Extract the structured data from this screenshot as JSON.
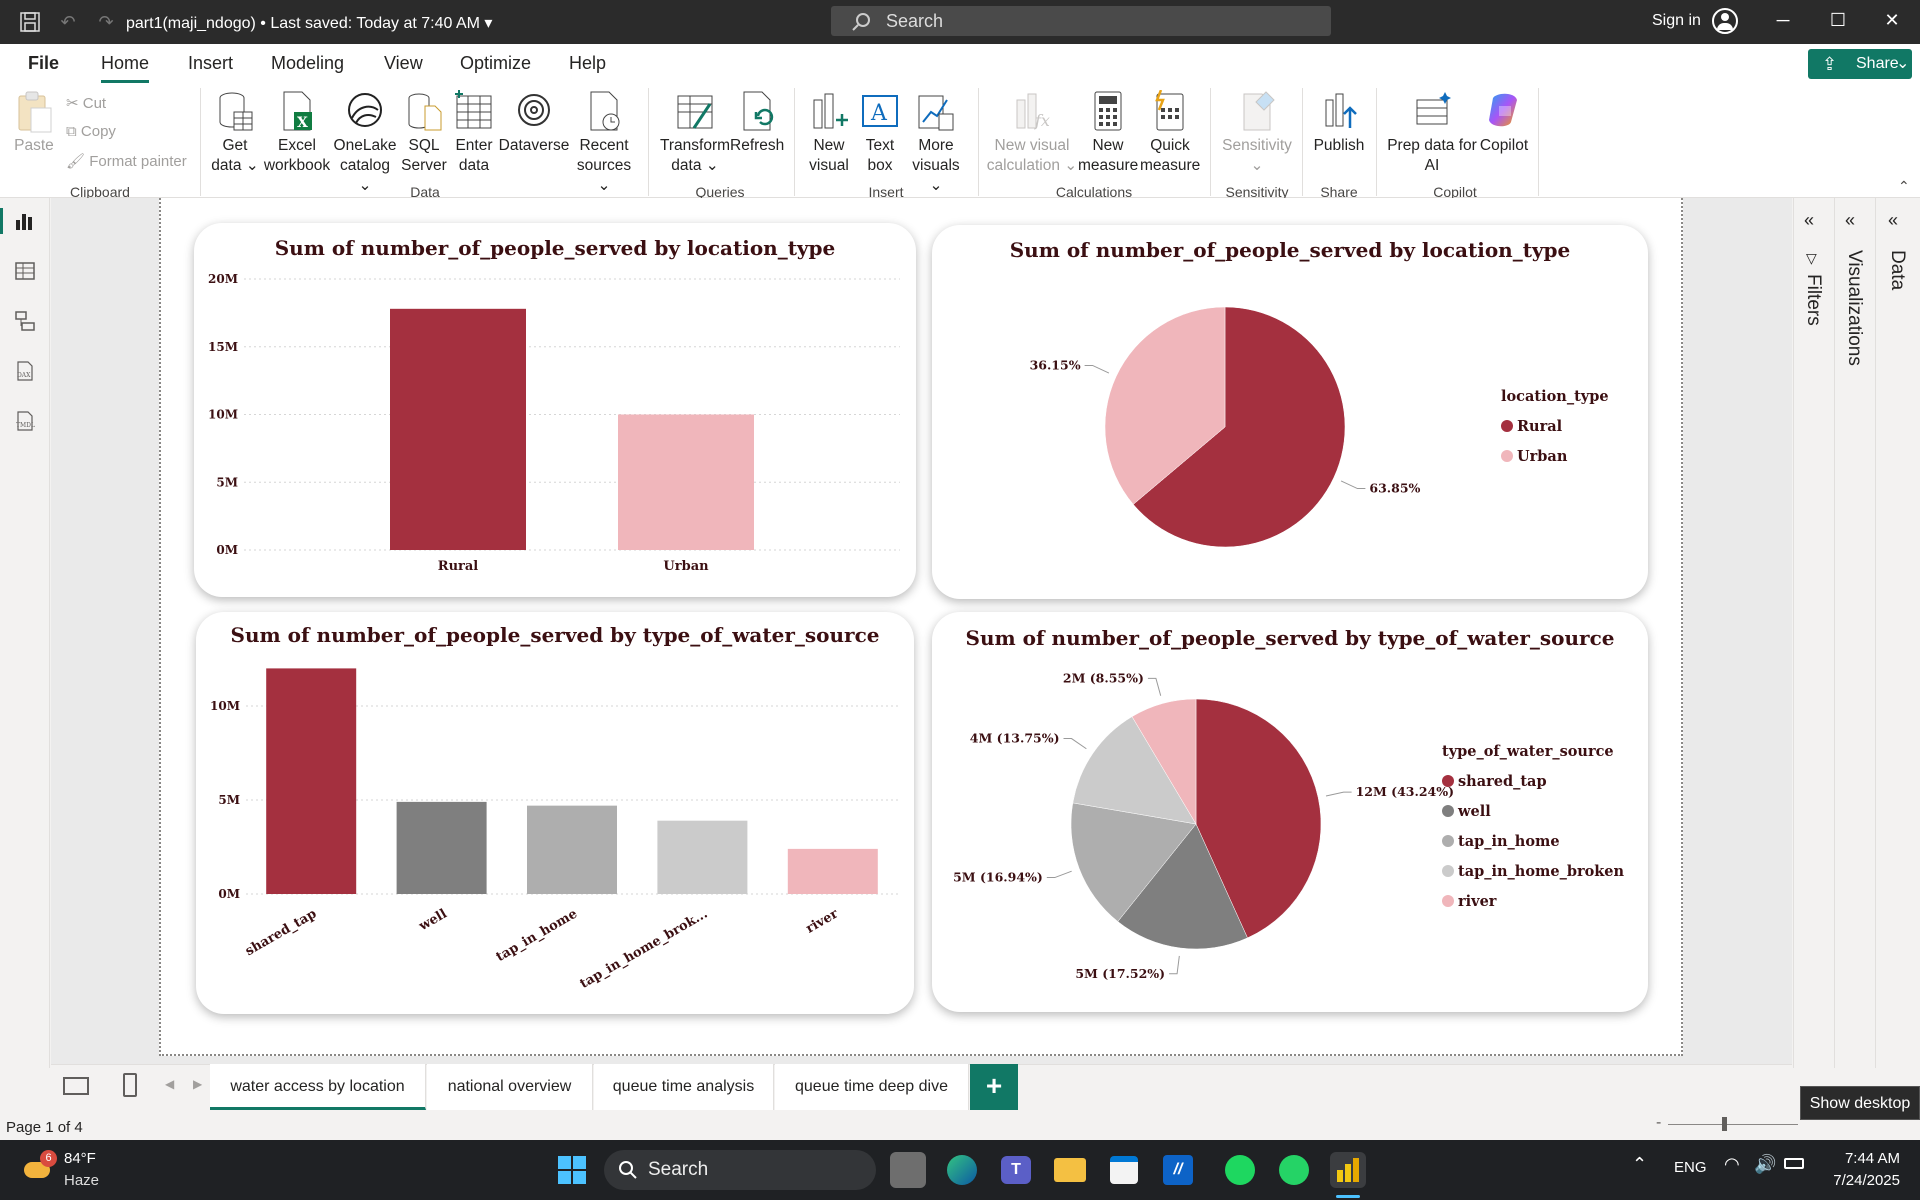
{
  "titlebar": {
    "file_title": "part1(maji_ndogo) • Last saved: Today at 7:40 AM",
    "search_label": "Search",
    "signin": "Sign in"
  },
  "menu": {
    "items": [
      "File",
      "Home",
      "Insert",
      "Modeling",
      "View",
      "Optimize",
      "Help"
    ],
    "share": "Share"
  },
  "ribbon": {
    "clipboard": {
      "paste": "Paste",
      "cut": "Cut",
      "copy": "Copy",
      "format_painter": "Format painter",
      "group": "Clipboard"
    },
    "data": {
      "get_data": [
        "Get",
        "data"
      ],
      "excel": [
        "Excel",
        "workbook"
      ],
      "onelake": [
        "OneLake",
        "catalog"
      ],
      "sql": [
        "SQL",
        "Server"
      ],
      "enter": [
        "Enter",
        "data"
      ],
      "dataverse": [
        "Dataverse"
      ],
      "recent": [
        "Recent",
        "sources"
      ],
      "group": "Data"
    },
    "queries": {
      "transform": [
        "Transform",
        "data"
      ],
      "refresh": [
        "Refresh"
      ],
      "group": "Queries"
    },
    "insert": {
      "new_visual": [
        "New",
        "visual"
      ],
      "text_box": [
        "Text",
        "box"
      ],
      "more_visuals": [
        "More",
        "visuals"
      ],
      "group": "Insert"
    },
    "calculations": {
      "new_visual_calc": [
        "New visual",
        "calculation"
      ],
      "new_measure": [
        "New",
        "measure"
      ],
      "quick_measure": [
        "Quick",
        "measure"
      ],
      "group": "Calculations"
    },
    "sensitivity": {
      "label": "Sensitivity",
      "group": "Sensitivity"
    },
    "share": {
      "publish": "Publish",
      "group": "Share"
    },
    "copilot": {
      "prep": [
        "Prep data for",
        "AI"
      ],
      "copilot": "Copilot",
      "group": "Copilot"
    }
  },
  "panes": {
    "filters": "Filters",
    "visualizations": "Visualizations",
    "data": "Data"
  },
  "colors": {
    "rural": "#a4303f",
    "urban": "#f0b6bb",
    "well": "#7f7f7f",
    "tap_in_home": "#aeaeae",
    "tap_in_home_broken": "#cbcbcb",
    "title": "#3b0f12",
    "accent": "#117865"
  },
  "chart_data": [
    {
      "type": "bar",
      "title": "Sum of number_of_people_served by location_type",
      "categories": [
        "Rural",
        "Urban"
      ],
      "values": [
        17.8,
        10.0
      ],
      "unit": "M",
      "yticks": [
        "0M",
        "5M",
        "10M",
        "15M",
        "20M"
      ],
      "ylim": [
        0,
        20
      ],
      "grid": true
    },
    {
      "type": "pie",
      "title": "Sum of number_of_people_served by location_type",
      "legend_title": "location_type",
      "categories": [
        "Rural",
        "Urban"
      ],
      "values": [
        63.85,
        36.15
      ],
      "labels": [
        "63.85%",
        "36.15%"
      ],
      "legend": "right"
    },
    {
      "type": "bar",
      "title": "Sum of number_of_people_served by type_of_water_source",
      "categories": [
        "shared_tap",
        "well",
        "tap_in_home",
        "tap_in_home_brok...",
        "river"
      ],
      "values": [
        12,
        4.9,
        4.7,
        3.9,
        2.4
      ],
      "unit": "M",
      "yticks": [
        "0M",
        "5M",
        "10M"
      ],
      "ylim": [
        0,
        12.5
      ],
      "grid": true
    },
    {
      "type": "pie",
      "title": "Sum of number_of_people_served by type_of_water_source",
      "legend_title": "type_of_water_source",
      "categories": [
        "shared_tap",
        "well",
        "tap_in_home",
        "tap_in_home_broken",
        "river"
      ],
      "values": [
        43.24,
        17.52,
        16.94,
        13.75,
        8.55
      ],
      "labels": [
        "12M (43.24%)",
        "5M (17.52%)",
        "5M (16.94%)",
        "4M (13.75%)",
        "2M (8.55%)"
      ],
      "legend": "right"
    }
  ],
  "pages": {
    "tabs": [
      "water access by location",
      "national overview",
      "queue time analysis",
      "queue time deep dive"
    ],
    "add": "+",
    "page_info": "Page 1 of 4",
    "tooltip": "Show desktop"
  },
  "taskbar": {
    "weather_badge": "6",
    "temp": "84°F",
    "condition": "Haze",
    "search": "Search",
    "lang": "ENG",
    "time": "7:44 AM",
    "date": "7/24/2025"
  }
}
